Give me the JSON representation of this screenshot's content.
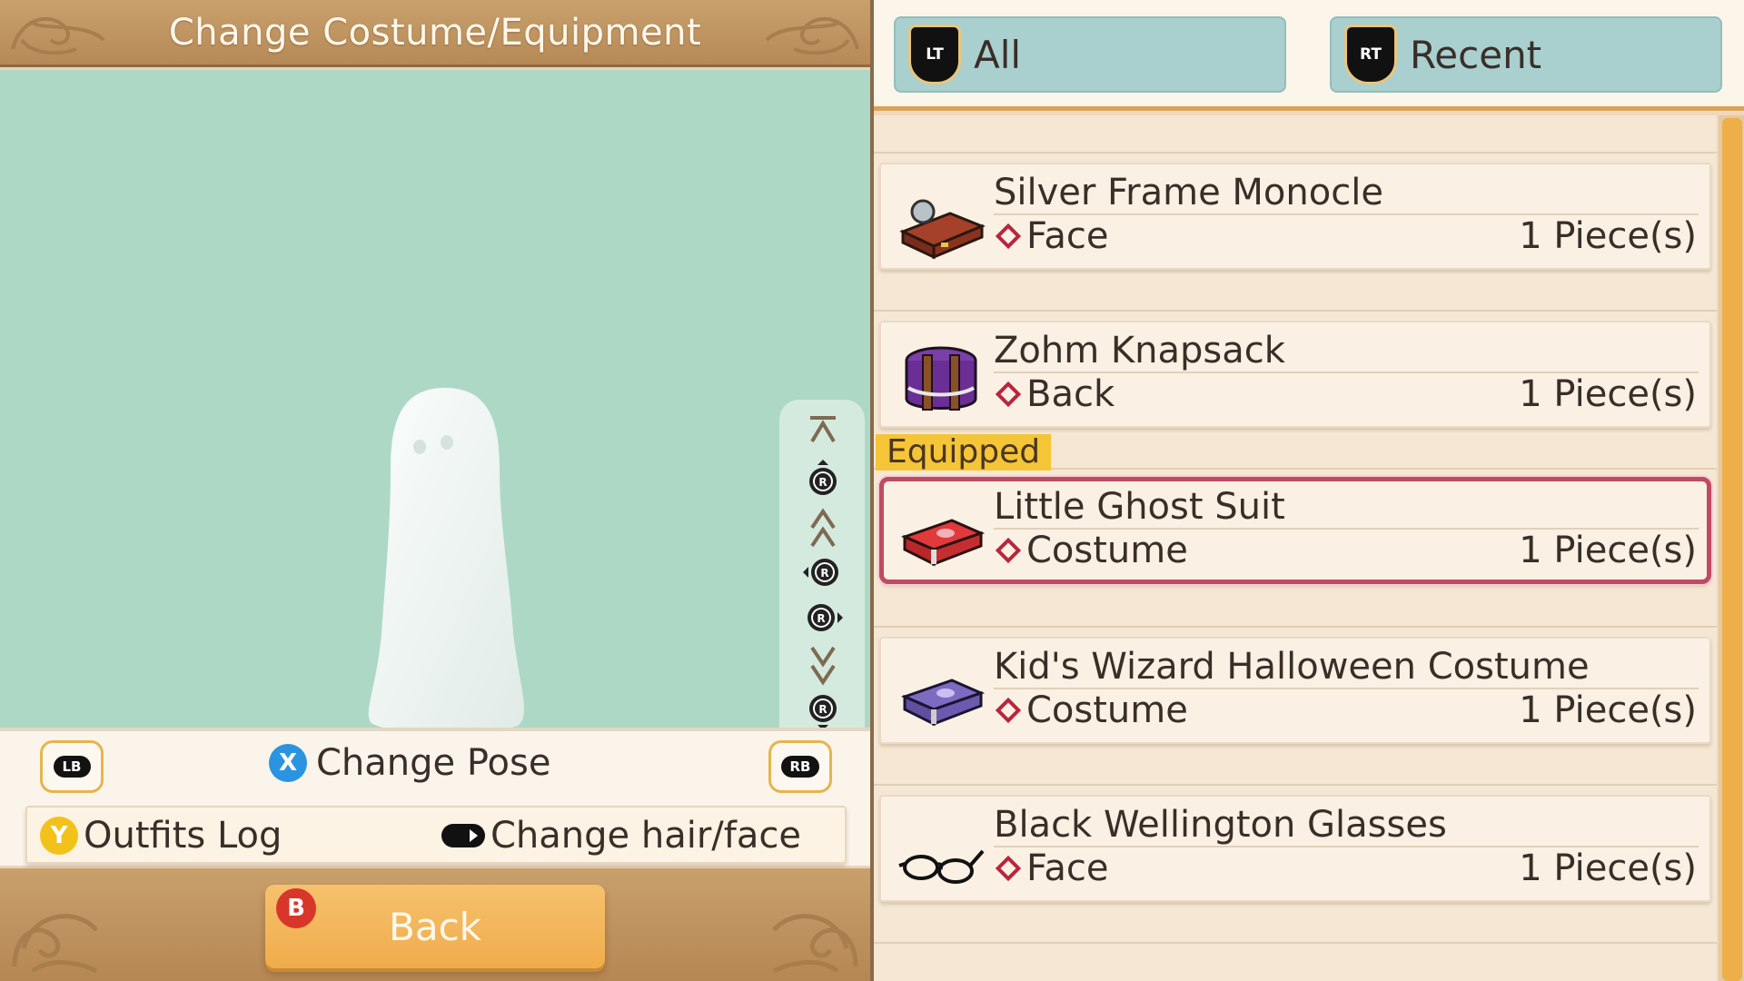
{
  "header": {
    "title": "Change Costume/Equipment"
  },
  "colors": {
    "viewport_bg": "#aed8c6",
    "accent_orange": "#eeae48",
    "selected_border": "#c04a62",
    "equipped_tag": "#f4c537"
  },
  "controls": {
    "lb": "LB",
    "rb": "RB",
    "pose_button": "X",
    "pose_label": "Change Pose",
    "outfits_button": "Y",
    "outfits_label": "Outfits Log",
    "hair_label": "Change hair/face"
  },
  "camera_strip": [
    "zoom-top-icon",
    "r-stick-up-icon",
    "move-up-icon",
    "r-stick-left-icon",
    "r-stick-right-icon",
    "move-down-icon",
    "r-stick-down-icon",
    "zoom-bottom-icon"
  ],
  "camera_stick_letter": "R",
  "footer": {
    "back_button": "B",
    "back_label": "Back"
  },
  "tabs": [
    {
      "trigger": "LT",
      "label": "All"
    },
    {
      "trigger": "RT",
      "label": "Recent"
    }
  ],
  "equipped_label": "Equipped",
  "items": [
    {
      "name": "Silver Frame Monocle",
      "slot": "Face",
      "qty": "1 Piece(s)",
      "icon": "monocle-case-icon",
      "equipped": false
    },
    {
      "name": "Zohm Knapsack",
      "slot": "Back",
      "qty": "1 Piece(s)",
      "icon": "knapsack-box-icon",
      "equipped": false
    },
    {
      "name": "Little Ghost Suit",
      "slot": "Costume",
      "qty": "1 Piece(s)",
      "icon": "red-costume-box-icon",
      "equipped": true
    },
    {
      "name": "Kid's Wizard Halloween Costume",
      "slot": "Costume",
      "qty": "1 Piece(s)",
      "icon": "purple-costume-box-icon",
      "equipped": false
    },
    {
      "name": "Black Wellington Glasses",
      "slot": "Face",
      "qty": "1 Piece(s)",
      "icon": "glasses-icon",
      "equipped": false
    }
  ]
}
